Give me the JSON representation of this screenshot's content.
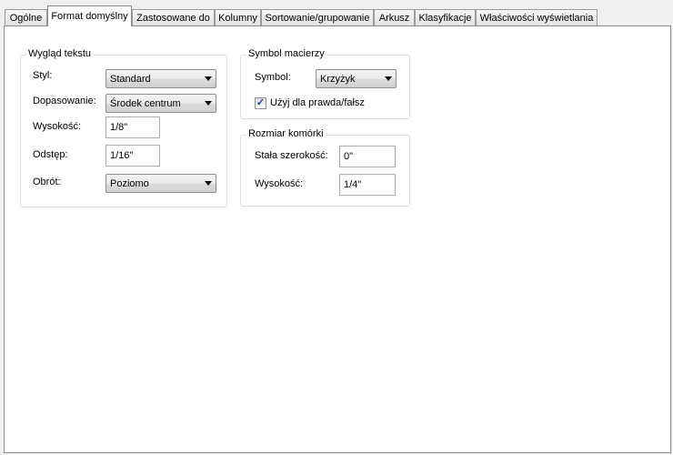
{
  "tabs": [
    {
      "label": "Ogólne"
    },
    {
      "label": "Format domyślny"
    },
    {
      "label": "Zastosowane do"
    },
    {
      "label": "Kolumny"
    },
    {
      "label": "Sortowanie/grupowanie"
    },
    {
      "label": "Arkusz"
    },
    {
      "label": "Klasyfikacje"
    },
    {
      "label": "Właściwości wyświetlania"
    }
  ],
  "active_tab": "Format domyślny",
  "text_appearance": {
    "title": "Wygląd tekstu",
    "style": {
      "label": "Styl:",
      "value": "Standard"
    },
    "justification": {
      "label": "Dopasowanie:",
      "value": "Środek centrum"
    },
    "height": {
      "label": "Wysokość:",
      "value": "1/8\""
    },
    "spacing": {
      "label": "Odstęp:",
      "value": "1/16\""
    },
    "rotation": {
      "label": "Obrót:",
      "value": "Poziomo"
    }
  },
  "matrix_symbol": {
    "title": "Symbol macierzy",
    "symbol": {
      "label": "Symbol:",
      "value": "Krzyżyk"
    },
    "use_for_boolean": {
      "label": "Użyj dla prawda/fałsz",
      "checked": true
    }
  },
  "cell_size": {
    "title": "Rozmiar komórki",
    "fixed_width": {
      "label": "Stała szerokość:",
      "value": "0\""
    },
    "height": {
      "label": "Wysokość:",
      "value": "1/4\""
    }
  }
}
